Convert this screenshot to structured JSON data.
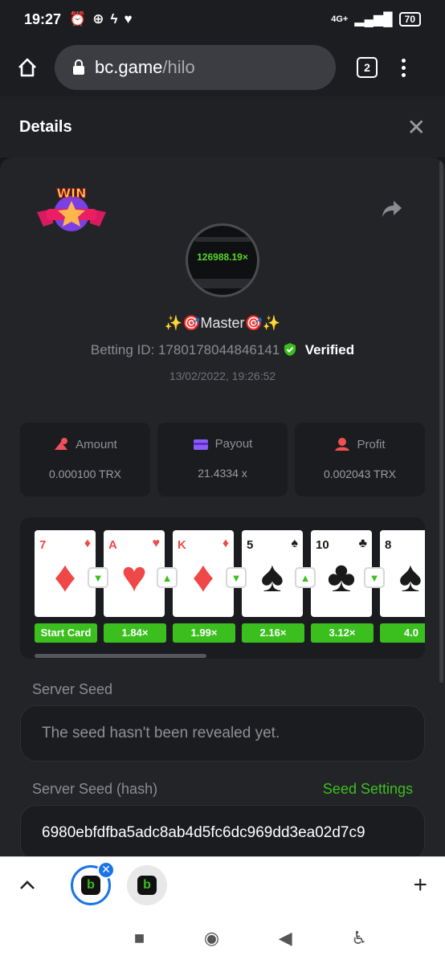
{
  "status_bar": {
    "time": "19:27",
    "network": "4G+",
    "battery": "70"
  },
  "browser": {
    "domain": "bc.game",
    "path": "/hilo",
    "tab_count": "2"
  },
  "header": {
    "title": "Details",
    "close": "✕"
  },
  "player": {
    "name": "✨🎯Master🎯✨",
    "avatar_multiplier": "126988.19×"
  },
  "bet": {
    "label": "Betting ID: 1780178044846141",
    "verified": "Verified",
    "datetime": "13/02/2022, 19:26:52"
  },
  "stats": [
    {
      "label": "Amount",
      "value": "0.000100 TRX",
      "color": "#f0505a"
    },
    {
      "label": "Payout",
      "value": "21.4334 x",
      "color": "#8b5cf6"
    },
    {
      "label": "Profit",
      "value": "0.002043 TRX",
      "color": "#f05050"
    }
  ],
  "cards": [
    {
      "rank": "7",
      "suit": "♦",
      "color": "red",
      "pill": "Start Card",
      "arrow": "lower"
    },
    {
      "rank": "A",
      "suit": "♥",
      "color": "red",
      "pill": "1.84×",
      "arrow": "higher"
    },
    {
      "rank": "K",
      "suit": "♦",
      "color": "red",
      "pill": "1.99×",
      "arrow": "lower"
    },
    {
      "rank": "5",
      "suit": "♠",
      "color": "black",
      "pill": "2.16×",
      "arrow": "higher"
    },
    {
      "rank": "10",
      "suit": "♣",
      "color": "black",
      "pill": "3.12×",
      "arrow": "lower"
    },
    {
      "rank": "8",
      "suit": "♠",
      "color": "black",
      "pill": "4.0",
      "arrow": ""
    }
  ],
  "server_seed": {
    "label": "Server Seed",
    "value": "The seed hasn't been revealed yet."
  },
  "server_seed_hash": {
    "label": "Server Seed (hash)",
    "value": "6980ebfdfba5adc8ab4d5fc6dc969dd3ea02d7c9",
    "link": "Seed Settings"
  },
  "bottom_tabs": {
    "add": "+"
  }
}
